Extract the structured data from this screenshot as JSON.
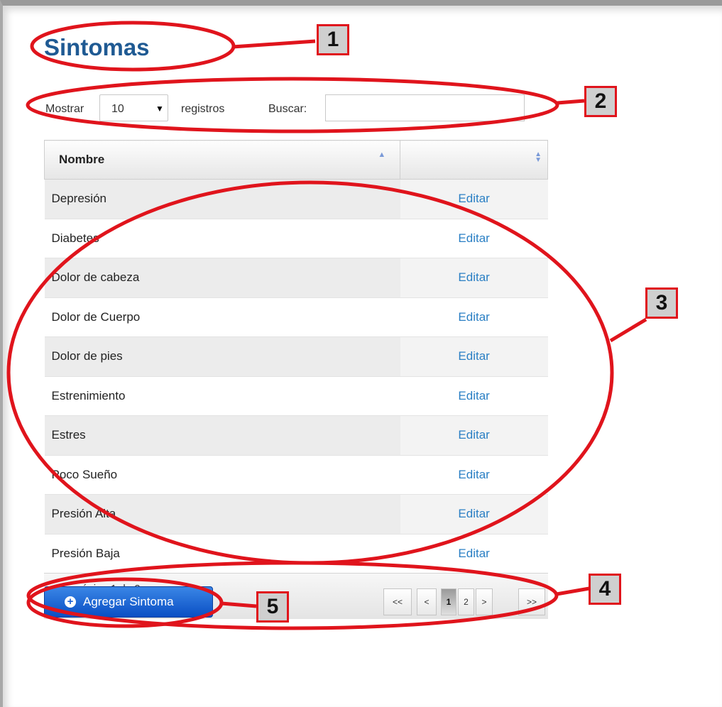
{
  "page": {
    "title": "Sintomas"
  },
  "controls": {
    "show_label": "Mostrar",
    "page_size": "10",
    "records_label": "registros",
    "search_label": "Buscar:",
    "search_value": ""
  },
  "table": {
    "columns": [
      "Nombre",
      ""
    ],
    "rows": [
      {
        "nombre": "Depresión",
        "action": "Editar"
      },
      {
        "nombre": "Diabetes",
        "action": "Editar"
      },
      {
        "nombre": "Dolor de cabeza",
        "action": "Editar"
      },
      {
        "nombre": "Dolor de Cuerpo",
        "action": "Editar"
      },
      {
        "nombre": "Dolor de pies",
        "action": "Editar"
      },
      {
        "nombre": "Estrenimiento",
        "action": "Editar"
      },
      {
        "nombre": "Estres",
        "action": "Editar"
      },
      {
        "nombre": "Poco Sueño",
        "action": "Editar"
      },
      {
        "nombre": "Presión Alta",
        "action": "Editar"
      },
      {
        "nombre": "Presión Baja",
        "action": "Editar"
      }
    ]
  },
  "pagination": {
    "info": "Ver página 1 de 2",
    "buttons": [
      "<<",
      "<",
      "1",
      "2",
      ">",
      ">>"
    ],
    "active": "1"
  },
  "add_button": {
    "label": "Agregar Sintoma"
  },
  "annotations": [
    "1",
    "2",
    "3",
    "4",
    "5"
  ],
  "colors": {
    "title": "#1f5a93",
    "link": "#2a7fc4",
    "button": "#0a4fc4",
    "annotation": "#e0141c"
  }
}
